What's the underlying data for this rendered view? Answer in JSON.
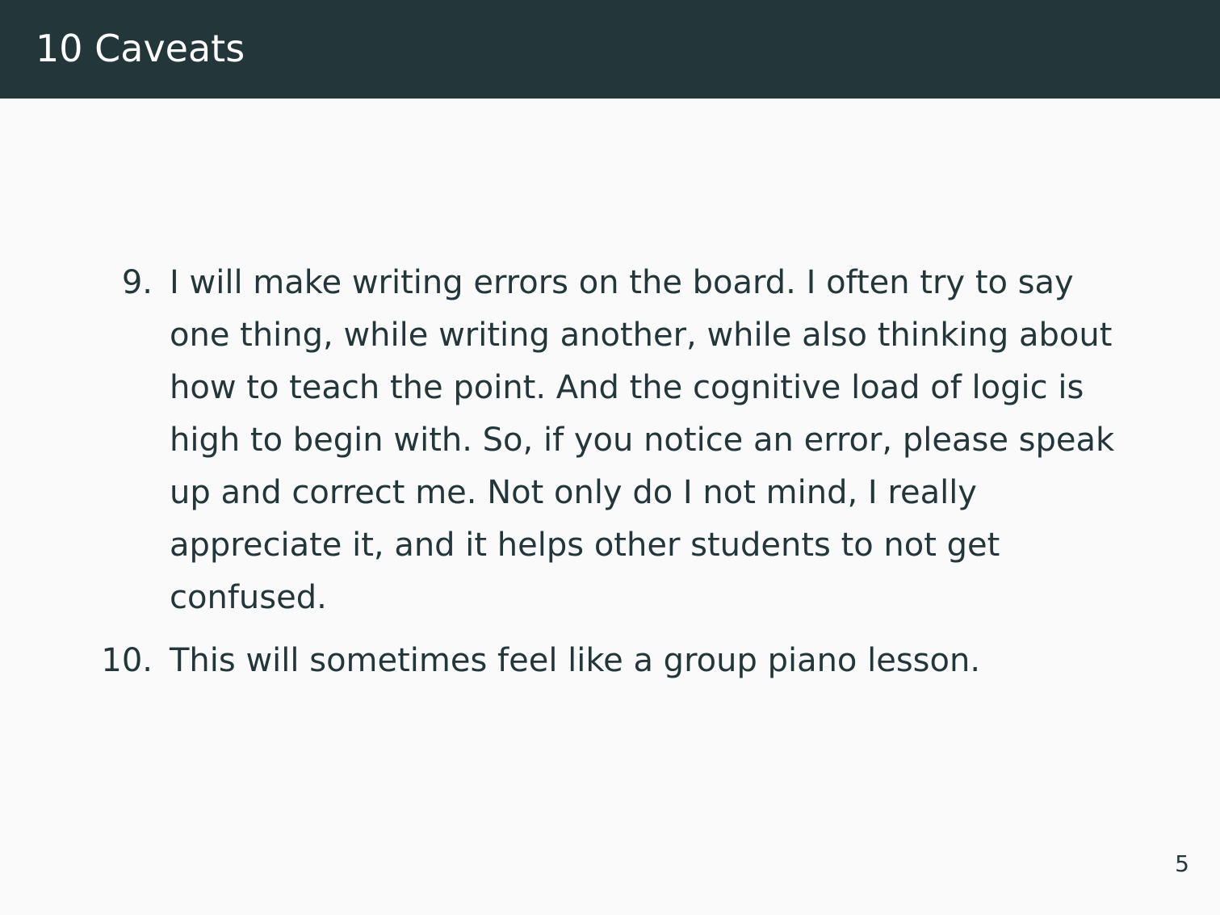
{
  "header": {
    "title": "10 Caveats"
  },
  "items": [
    {
      "number": "9.",
      "text": "I will make writing errors on the board. I often try to say one thing, while writing another, while also thinking about how to teach the point. And the cognitive load of logic is high to begin with. So, if you notice an error, please speak up and correct me. Not only do I not mind, I really appreciate it, and it helps other students to not get confused."
    },
    {
      "number": "10.",
      "text": "This will sometimes feel like a group piano lesson."
    }
  ],
  "footer": {
    "page_number": "5"
  },
  "colors": {
    "header_background": "#23373b",
    "body_background": "#fafafa",
    "text": "#23373b"
  }
}
